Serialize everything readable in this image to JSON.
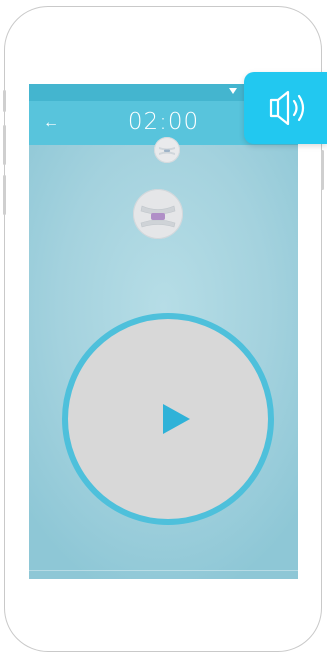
{
  "toolbar": {
    "back_icon": "arrow-left-icon",
    "back_glyph": "←",
    "timer": "02:00"
  },
  "status_bar": {
    "wifi_icon": "wifi-icon"
  },
  "exercise": {
    "small_icon": "oral-stretch-small-icon",
    "large_icon": "oral-stretch-large-icon"
  },
  "player": {
    "play_icon": "play-icon"
  },
  "overlay": {
    "volume_icon": "speaker-volume-icon"
  },
  "colors": {
    "status_bar": "#44b5cf",
    "toolbar": "#58c4dc",
    "ring": "#4ec0db",
    "play": "#2fb2d8",
    "volume_bg": "#22c8f0"
  }
}
